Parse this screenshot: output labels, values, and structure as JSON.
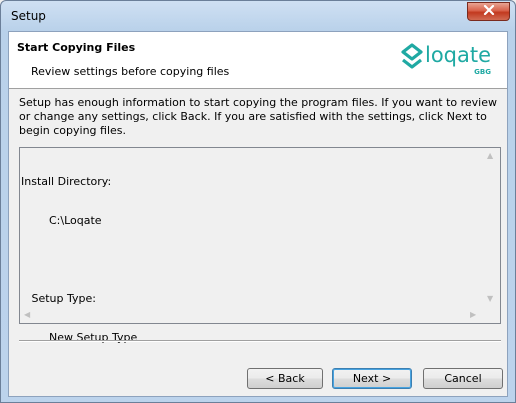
{
  "window": {
    "title": "Setup"
  },
  "header": {
    "title": "Start Copying Files",
    "subtitle": "Review settings before copying files",
    "logo": {
      "word": "loqate",
      "tag": "GBG",
      "color": "#1fa9a3"
    }
  },
  "description": "Setup has enough information to start copying the program files.  If you want to review or change any settings, click Back.  If you are satisfied with the settings, click Next to begin copying files.",
  "summary": {
    "lines": [
      "Install Directory:",
      "        C:\\Loqate",
      "",
      "   Setup Type:",
      "        New Setup Type"
    ]
  },
  "buttons": {
    "back": "< Back",
    "next": "Next >",
    "cancel": "Cancel"
  }
}
